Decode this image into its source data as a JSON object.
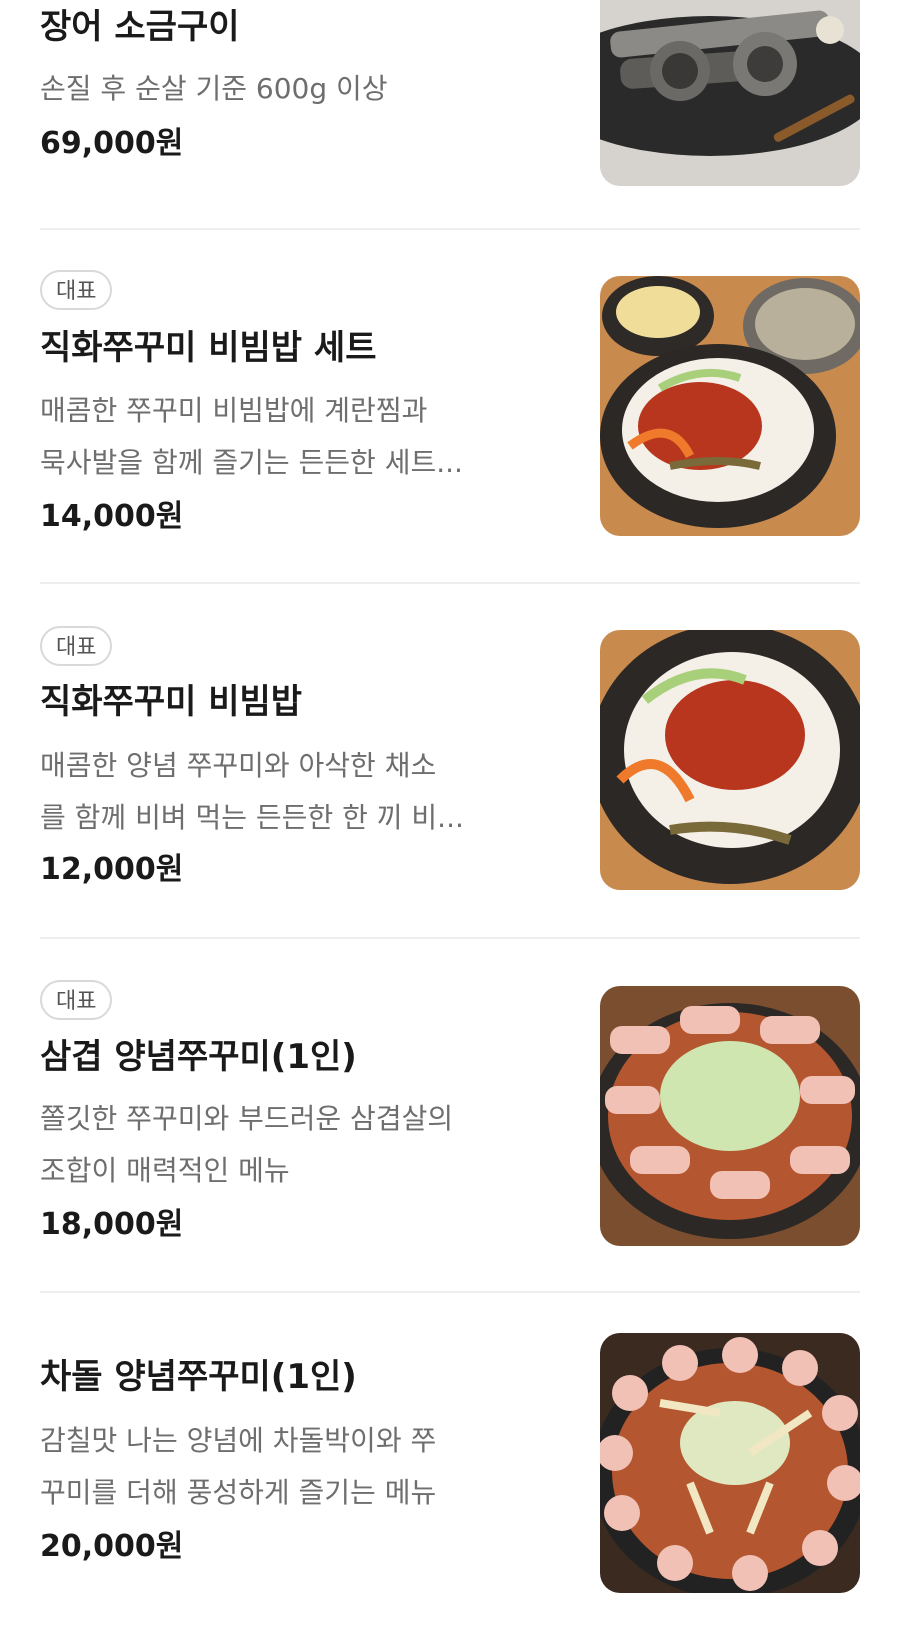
{
  "menu": {
    "items": [
      {
        "name": "장어 소금구이",
        "badge": "",
        "desc_lines": [
          "손질 후 순살 기준 600g 이상"
        ],
        "price": "69,000원",
        "image_icon": "grilled-eel-photo"
      },
      {
        "name": "직화쭈꾸미 비빔밥 세트",
        "badge": "대표",
        "desc_lines": [
          "매콤한 쭈꾸미 비빔밥에 계란찜과",
          "묵사발을 함께 즐기는 든든한 세트..."
        ],
        "price": "14,000원",
        "image_icon": "bibimbap-set-photo"
      },
      {
        "name": "직화쭈꾸미 비빔밥",
        "badge": "대표",
        "desc_lines": [
          "매콤한 양념 쭈꾸미와 아삭한 채소",
          "를 함께 비벼 먹는 든든한 한 끼 비..."
        ],
        "price": "12,000원",
        "image_icon": "bibimbap-bowl-photo"
      },
      {
        "name": "삼겹 양념쭈꾸미(1인)",
        "badge": "대표",
        "desc_lines": [
          "쫄깃한 쭈꾸미와 부드러운 삼겹살의",
          "조합이 매력적인 메뉴"
        ],
        "price": "18,000원",
        "image_icon": "samgyeop-jjukkumi-photo"
      },
      {
        "name": "차돌 양념쭈꾸미(1인)",
        "badge": "",
        "desc_lines": [
          "감칠맛 나는 양념에 차돌박이와 쭈",
          "꾸미를 더해 풍성하게 즐기는 메뉴"
        ],
        "price": "20,000원",
        "image_icon": "chadol-jjukkumi-photo"
      }
    ]
  }
}
